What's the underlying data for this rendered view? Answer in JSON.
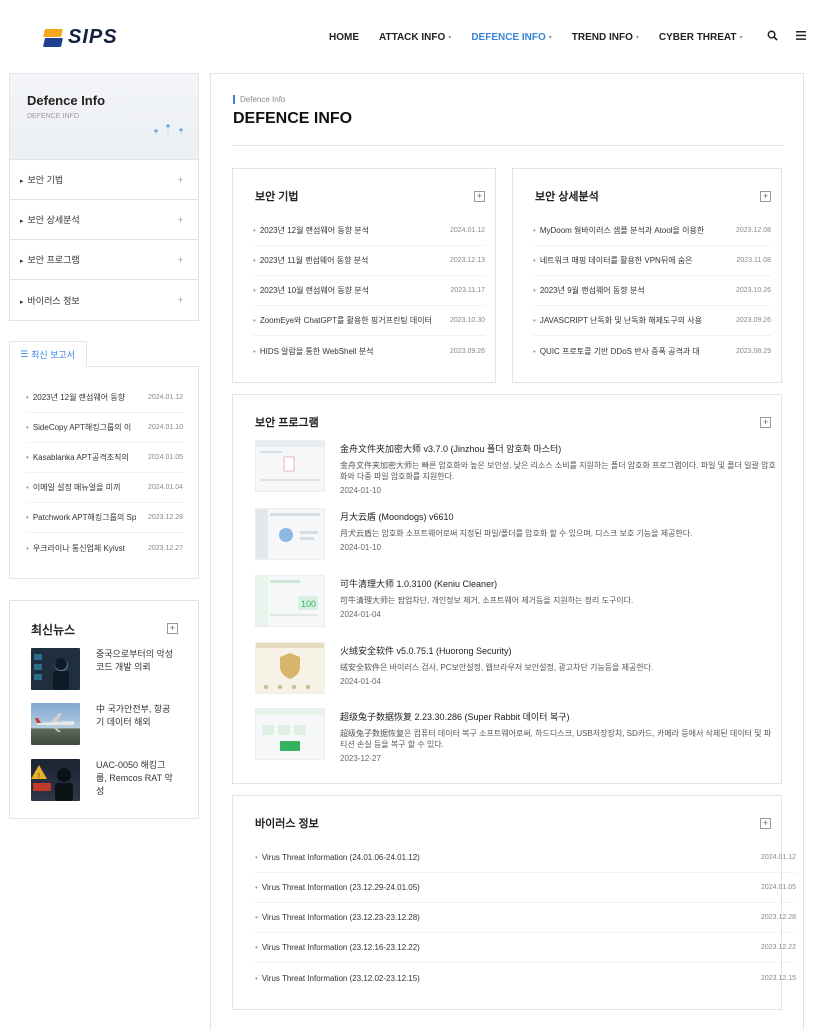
{
  "header": {
    "logo_text": "SIPS",
    "nav": [
      {
        "label": "HOME",
        "caret": false,
        "active": false
      },
      {
        "label": "ATTACK INFO",
        "caret": true,
        "active": false
      },
      {
        "label": "DEFENCE INFO",
        "caret": true,
        "active": true
      },
      {
        "label": "TREND INFO",
        "caret": true,
        "active": false
      },
      {
        "label": "CYBER THREAT",
        "caret": true,
        "active": false
      }
    ],
    "search_icon": "search-icon",
    "menu_icon": "hamburger-menu-icon"
  },
  "sidebar": {
    "title": "Defence Info",
    "subtitle": "DEFENCE INFO",
    "items": [
      {
        "label": "보안 기법"
      },
      {
        "label": "보안 상세분석"
      },
      {
        "label": "보안 프로그램"
      },
      {
        "label": "바이러스 정보"
      }
    ],
    "plus": "+"
  },
  "reports": {
    "tab_label": "최신 보고서",
    "items": [
      {
        "title": "2023년 12월 랜섬웨어 동향",
        "date": "2024.01.12"
      },
      {
        "title": "SideCopy APT해킹그룹의 이",
        "date": "2024.01.10"
      },
      {
        "title": "Kasablanka APT공격조직의",
        "date": "2024.01.05"
      },
      {
        "title": "이메일 설정 매뉴얼을 미끼",
        "date": "2024.01.04"
      },
      {
        "title": "Patchwork APT해킹그룹의 Sp",
        "date": "2023.12.28"
      },
      {
        "title": "우크라이나 통신업체 Kyivst",
        "date": "2023.12.27"
      }
    ]
  },
  "news": {
    "title": "최신뉴스",
    "items": [
      {
        "text": "중국으로부터의 악성코드 개발 의뢰"
      },
      {
        "text": "中 국가안전부, 항공기 데이터 해외"
      },
      {
        "text": "UAC-0050 해킹그룹, Remcos RAT 악성"
      }
    ]
  },
  "main": {
    "breadcrumb": "Defence Info",
    "title": "DEFENCE INFO",
    "tech": {
      "title": "보안 기법",
      "items": [
        {
          "title": "2023년 12월 랜섬웨어 동향 분석",
          "date": "2024.01.12"
        },
        {
          "title": "2023년 11월 랜섬웨어 동향 분석",
          "date": "2023.12.13"
        },
        {
          "title": "2023년 10월 랜섬웨어 동향 분석",
          "date": "2023.11.17"
        },
        {
          "title": "ZoomEye와 ChatGPT를 활용한 핑거프린팅 데이터",
          "date": "2023.10.30"
        },
        {
          "title": "HIDS 알람을 통한 WebShell 분석",
          "date": "2023.09.26"
        }
      ]
    },
    "analysis": {
      "title": "보안 상세분석",
      "items": [
        {
          "title": "MyDoom 웜바이러스 샘플 분석과 Atool을 이용한",
          "date": "2023.12.08"
        },
        {
          "title": "네트워크 매핑 데이터를 활용한 VPN뒤에 숨은",
          "date": "2023.11.08"
        },
        {
          "title": "2023년 9월 랜섬웨어 동향 분석",
          "date": "2023.10.26"
        },
        {
          "title": "JAVASCRIPT 난독화 및 난독화 해제도구의 사용",
          "date": "2023.09.26"
        },
        {
          "title": "QUIC 프로토콜 기반 DDoS 반사 증폭 공격과 대",
          "date": "2023.08.29"
        }
      ]
    },
    "programs": {
      "title": "보안 프로그램",
      "items": [
        {
          "name": "金舟文件夹加密大师 v3.7.0 (Jinzhou 폴더 암호화 마스터)",
          "desc": "金舟文件夹加密大师는 빠른 암호화와 높은 보안성, 낮은 리소스 소비를 지원하는 폴더 암호화 프로그램이다. 파일 및 폴더 일괄 암호화와 다중 파일 암호화를 지원한다.",
          "date": "2024-01-10"
        },
        {
          "name": "月大云盾 (Moondogs) v6610",
          "desc": "月犬云盾는 암호화 소프트웨어로써 지정된 파일/폴더를 암호화 할 수 있으며, 디스크 보호 기능을 제공한다.",
          "date": "2024-01-10"
        },
        {
          "name": "可牛清理大师 1.0.3100 (Keniu Cleaner)",
          "desc": "可牛清理大师는 팝업차단, 개인정보 제거, 소프트웨어 제거등을 지원하는 정리 도구이다.",
          "date": "2024-01-04"
        },
        {
          "name": "火绒安全软件 v5.0.75.1 (Huorong Security)",
          "desc": "绒安全软件은 바이러스 검사, PC보안설정, 웹브라우저 보안설정, 광고차단 기능등을 제공한다.",
          "date": "2024-01-04"
        },
        {
          "name": "超级兔子数据恢复 2.23.30.286 (Super Rabbit 데이터 복구)",
          "desc": "超级兔子数据恢复은 컴퓨터 데이터 복구 소프트웨어로써, 하드디스크, USB저장장치, SD카드, 카메라 등에서 삭제된 데이터 및 파티션 손실 등을 복구 할 수 있다.",
          "date": "2023-12-27"
        }
      ]
    },
    "virus": {
      "title": "바이러스 정보",
      "items": [
        {
          "title": "Virus Threat Information (24.01.06-24.01.12)",
          "date": "2024.01.12"
        },
        {
          "title": "Virus Threat Information (23.12.29-24.01.05)",
          "date": "2024.01.05"
        },
        {
          "title": "Virus Threat Information (23.12.23-23.12.28)",
          "date": "2023.12.28"
        },
        {
          "title": "Virus Threat Information (23.12.16-23.12.22)",
          "date": "2023.12.22"
        },
        {
          "title": "Virus Threat Information (23.12.02-23.12.15)",
          "date": "2023.12.15"
        }
      ]
    },
    "plus": "+"
  },
  "colors": {
    "accent": "#3a84d8",
    "border": "#e3e3e3",
    "logo_orange": "#f2a81d",
    "logo_navy": "#1f3f8f"
  }
}
